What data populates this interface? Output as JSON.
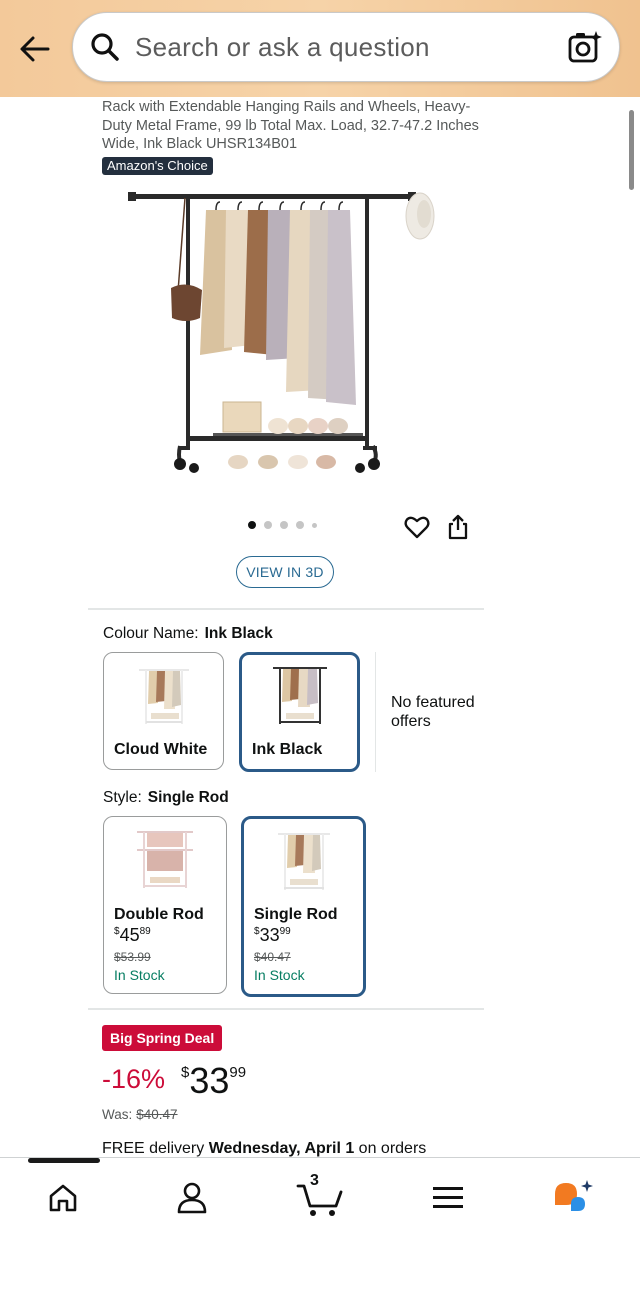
{
  "header": {
    "search_placeholder": "Search or ask a question"
  },
  "product": {
    "title": "Rack with Extendable Hanging Rails and Wheels, Heavy-Duty Metal Frame, 99 lb Total Max. Load, 32.7-47.2 Inches Wide, Ink Black UHSR134B01",
    "badge": "Amazon's Choice",
    "view_3d": "VIEW IN 3D",
    "image_dots": 5,
    "active_dot": 0
  },
  "colour": {
    "label": "Colour Name:",
    "value": "Ink Black",
    "options": [
      {
        "name": "Cloud White",
        "selected": false
      },
      {
        "name": "Ink Black",
        "selected": true
      }
    ],
    "no_offers": "No featured offers"
  },
  "style": {
    "label": "Style:",
    "value": "Single Rod",
    "options": [
      {
        "name": "Double Rod",
        "currency": "$",
        "price_whole": "45",
        "price_fraction": "89",
        "was": "$53.99",
        "stock": "In Stock",
        "selected": false
      },
      {
        "name": "Single Rod",
        "currency": "$",
        "price_whole": "33",
        "price_fraction": "99",
        "was": "$40.47",
        "stock": "In Stock",
        "selected": true
      }
    ]
  },
  "deal": {
    "badge": "Big Spring Deal",
    "discount": "-16%",
    "currency": "$",
    "price_whole": "33",
    "price_fraction": "99",
    "was_label": "Was:",
    "was_price": "$40.47"
  },
  "delivery": {
    "prefix": "FREE delivery ",
    "date": "Wednesday, April 1",
    "suffix": " on orders"
  },
  "bottom_nav": {
    "cart_count": "3",
    "items": [
      "home-icon",
      "account-icon",
      "cart-icon",
      "menu-icon",
      "rufus-icon"
    ]
  },
  "colors": {
    "header_bg": "#f3c99a",
    "selected_border": "#2b5a88",
    "deal_red": "#cc0c39",
    "stock_green": "#067d62",
    "badge_dark": "#232f3e"
  }
}
